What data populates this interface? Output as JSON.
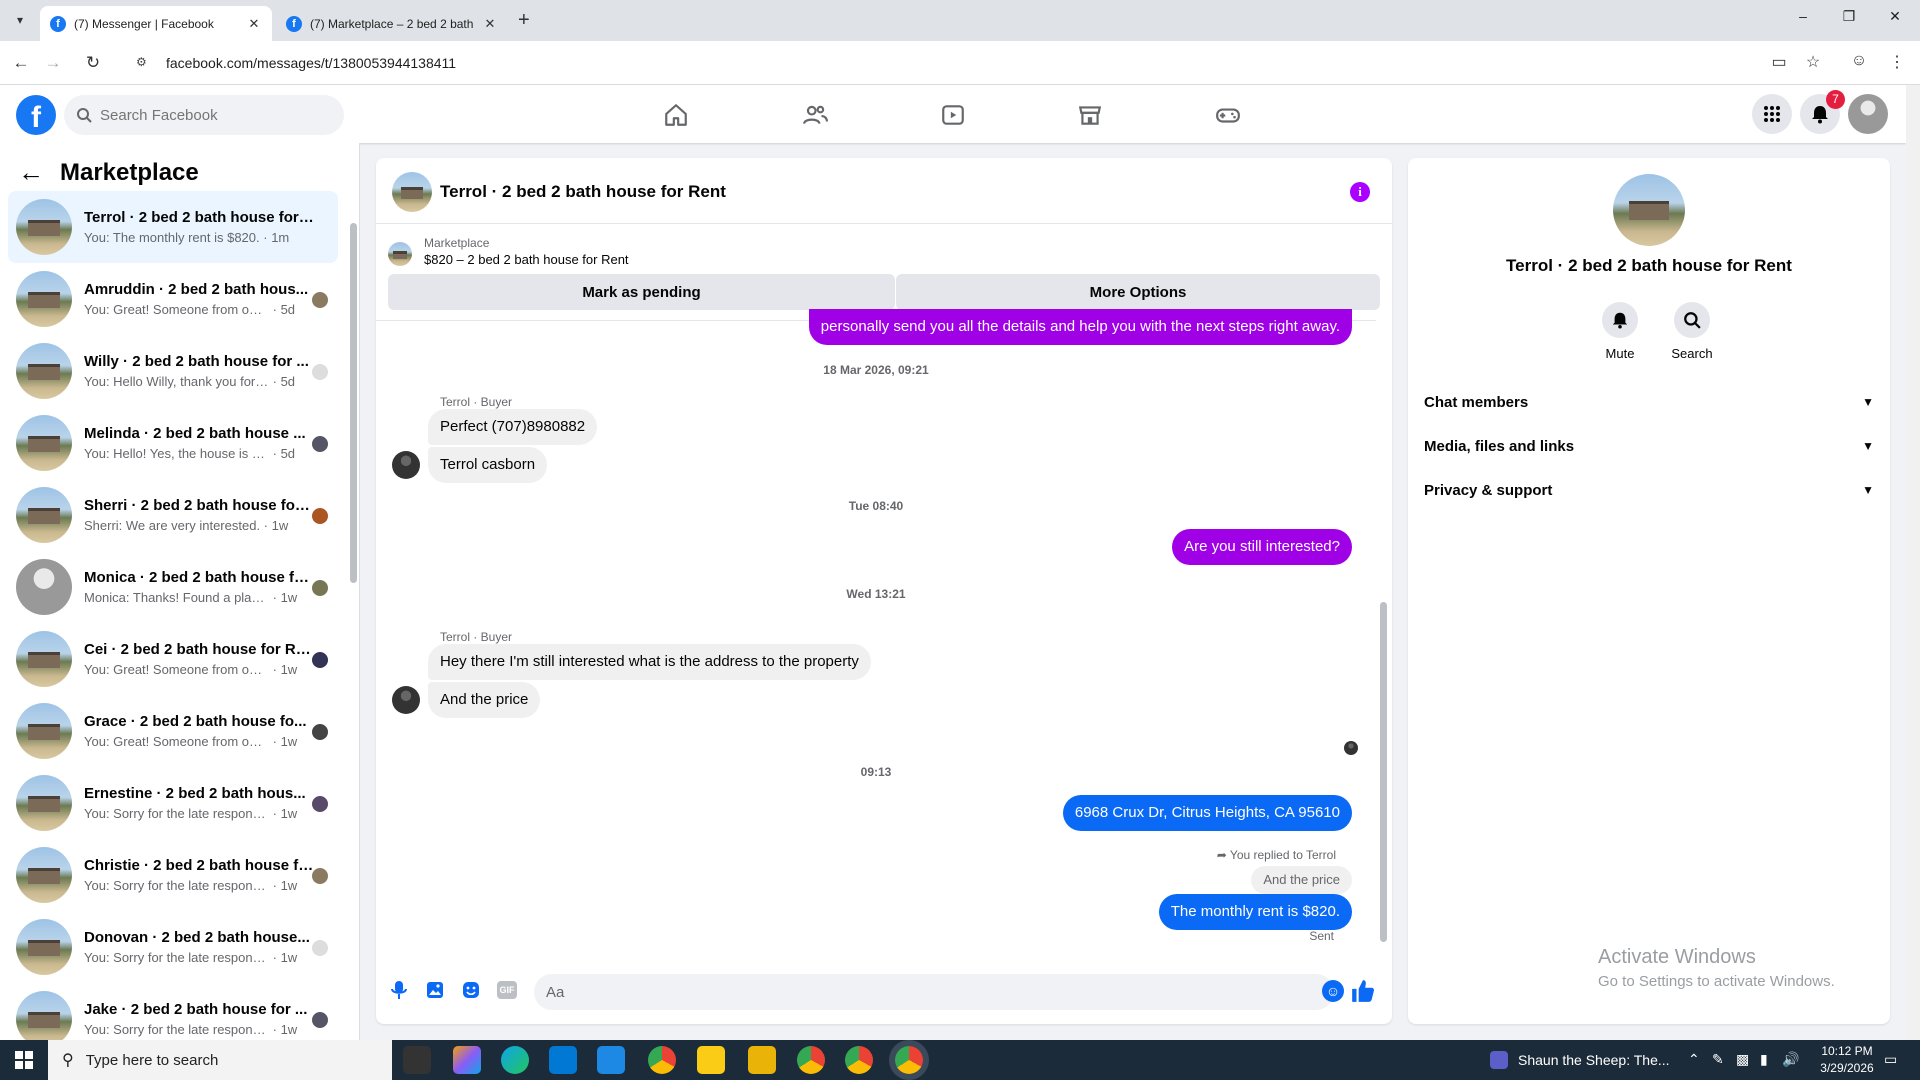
{
  "browser": {
    "tabs": [
      {
        "title": "(7) Messenger | Facebook",
        "active": true
      },
      {
        "title": "(7) Marketplace – 2 bed 2 bath",
        "active": false
      }
    ],
    "url": "facebook.com/messages/t/1380053944138411"
  },
  "fb_header": {
    "logo": "f",
    "search_placeholder": "Search Facebook",
    "notification_count": "7",
    "nav_icons": [
      "home-icon",
      "friends-icon",
      "video-icon",
      "marketplace-icon",
      "gaming-icon"
    ]
  },
  "left_panel": {
    "title": "Marketplace",
    "chats": [
      {
        "name": "Terrol · 2 bed 2 bath house for R...",
        "snippet": "You: The monthly rent is $820.",
        "time": "1m",
        "active": true
      },
      {
        "name": "Amruddin · 2 bed 2 bath hous...",
        "snippet": "You: Great! Someone from our t...",
        "time": "5d"
      },
      {
        "name": "Willy · 2 bed 2 bath house for ...",
        "snippet": "You: Hello Willy, thank you for le...",
        "time": "5d"
      },
      {
        "name": "Melinda · 2 bed 2 bath house ...",
        "snippet": "You: Hello! Yes, the house is still ...",
        "time": "5d"
      },
      {
        "name": "Sherri · 2 bed 2 bath house for R...",
        "snippet": "Sherri: We are very interested.",
        "time": "1w"
      },
      {
        "name": "Monica · 2 bed 2 bath house for...",
        "snippet": "Monica: Thanks! Found a place! To...",
        "time": "1w"
      },
      {
        "name": "Cei · 2 bed 2 bath house for Rent",
        "snippet": "You: Great! Someone from our tea...",
        "time": "1w"
      },
      {
        "name": "Grace · 2 bed 2 bath house fo...",
        "snippet": "You: Great! Someone from our t...",
        "time": "1w"
      },
      {
        "name": "Ernestine · 2 bed 2 bath hous...",
        "snippet": "You: Sorry for the late response ...",
        "time": "1w"
      },
      {
        "name": "Christie · 2 bed 2 bath house for...",
        "snippet": "You: Sorry for the late response — ...",
        "time": "1w"
      },
      {
        "name": "Donovan · 2 bed 2 bath house...",
        "snippet": "You: Sorry for the late response ...",
        "time": "1w"
      },
      {
        "name": "Jake · 2 bed 2 bath house for ...",
        "snippet": "You: Sorry for the late response ...",
        "time": "1w"
      }
    ]
  },
  "conversation": {
    "title": "Terrol · 2 bed 2 bath house for Rent",
    "listing_label": "Marketplace",
    "listing_price": "$820 – 2 bed 2 bath house for Rent",
    "mark_pending": "Mark as pending",
    "more_options": "More Options",
    "partial_message": "personally send you all the details and help you with the next steps right away.",
    "ts1": "18 Mar 2026, 09:21",
    "sender1": "Terrol · Buyer",
    "in_msg1": "Perfect (707)8980882",
    "in_msg2": "Terrol casborn",
    "ts2": "Tue 08:40",
    "out_msg1": "Are you still interested?",
    "ts3": "Wed 13:21",
    "sender2": "Terrol · Buyer",
    "in_msg3": "Hey there I'm still interested what is the address to the property",
    "in_msg4": "And the price",
    "ts4": "09:13",
    "out_msg2": "6968 Crux Dr, Citrus Heights, CA 95610",
    "replied_note": "You replied to Terrol",
    "quoted": "And the price",
    "out_msg3": "The monthly rent is $820.",
    "status": "Sent",
    "composer_placeholder": "Aa",
    "gif_label": "GIF"
  },
  "right_panel": {
    "name": "Terrol · 2 bed 2 bath house for Rent",
    "mute": "Mute",
    "search": "Search",
    "sections": [
      "Chat members",
      "Media, files and links",
      "Privacy & support"
    ],
    "activate_title": "Activate Windows",
    "activate_sub": "Go to Settings to activate Windows."
  },
  "taskbar": {
    "search_placeholder": "Type here to search",
    "media": "Shaun the Sheep: The...",
    "time": "10:12 PM",
    "date": "3/29/2026"
  },
  "colors": {
    "fb_blue": "#1877f2",
    "messenger_purple": "#a000e6",
    "messenger_blue": "#0a6af5",
    "badge_red": "#e41e3f"
  }
}
